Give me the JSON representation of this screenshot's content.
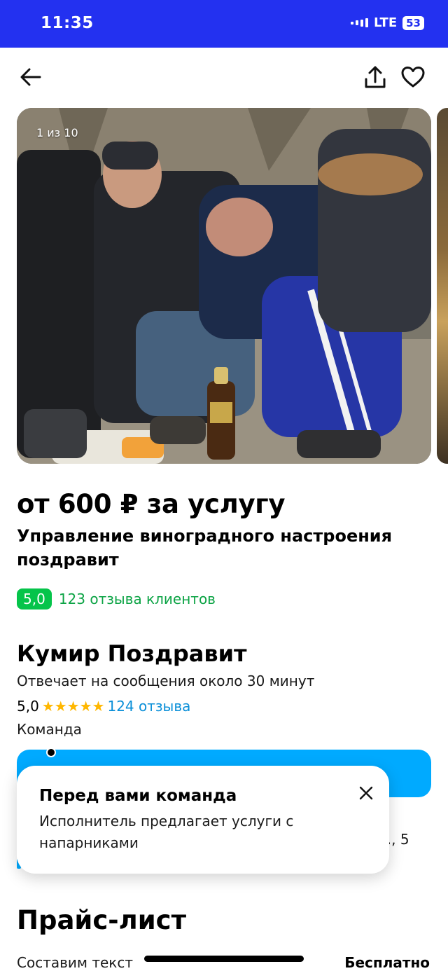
{
  "status_bar": {
    "time": "11:35",
    "network": "LTE",
    "battery": "53",
    "background": "#2331f0"
  },
  "nav": {
    "back_icon": "arrow-left-icon",
    "share_icon": "share-icon",
    "favorite_icon": "heart-icon"
  },
  "gallery": {
    "counter": "1 из 10"
  },
  "listing": {
    "price": "от 600 ₽ за услугу",
    "title": "Управление виноградного настроения поздравит",
    "rating": "5,0",
    "reviews": "123 отзыва клиентов"
  },
  "provider": {
    "name": "Кумир Поздравит",
    "response_time": "Отвечает на сообщения около 30 минут",
    "rating": "5,0",
    "stars": "★★★★★",
    "reviews": "124 отзыва",
    "type": "Команда",
    "address_partial": "л., 5"
  },
  "tooltip": {
    "title": "Перед вами команда",
    "text": "Исполнитель предлагает услуги с напарниками",
    "close_icon": "close-icon"
  },
  "pricelist": {
    "title": "Прайс-лист",
    "items": [
      {
        "name": "Составим текст",
        "price": "Бесплатно"
      }
    ]
  },
  "colors": {
    "accent": "#00aaff",
    "rating_green": "#05c44a",
    "link_blue": "#0a8fd8",
    "star": "#ffb700"
  }
}
